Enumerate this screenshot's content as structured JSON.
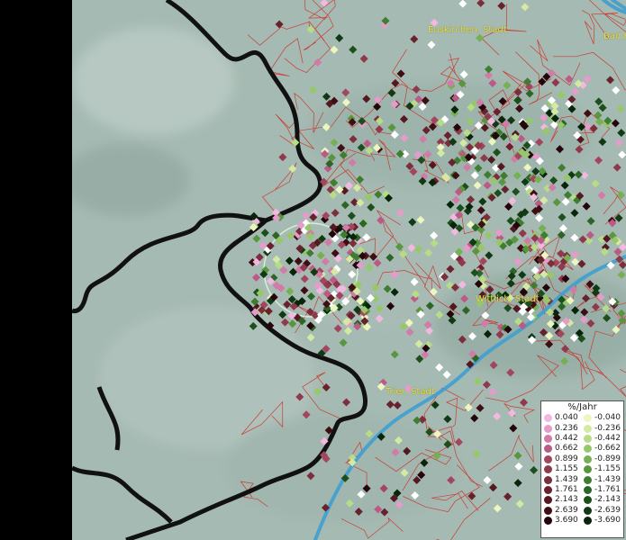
{
  "map": {
    "city_labels": [
      {
        "id": "euskirchen",
        "text": "Euskirchen, Stadt"
      },
      {
        "id": "bad",
        "text": "Bad H"
      },
      {
        "id": "wittlich",
        "text": "Wittlich, Stadt"
      },
      {
        "id": "trier",
        "text": "Trier, Stadt"
      }
    ]
  },
  "legend": {
    "title": "%/Jahr",
    "positive": [
      {
        "value": "0.040",
        "color": "#f2b8e0"
      },
      {
        "value": "0.236",
        "color": "#e59ccb"
      },
      {
        "value": "0.442",
        "color": "#d27aa8"
      },
      {
        "value": "0.662",
        "color": "#bb5a84"
      },
      {
        "value": "0.899",
        "color": "#a3455f"
      },
      {
        "value": "1.155",
        "color": "#8f3a4c"
      },
      {
        "value": "1.439",
        "color": "#7c2e3c"
      },
      {
        "value": "1.761",
        "color": "#68222d"
      },
      {
        "value": "2.143",
        "color": "#541820"
      },
      {
        "value": "2.639",
        "color": "#3e0e14"
      },
      {
        "value": "3.690",
        "color": "#26050a"
      }
    ],
    "negative": [
      {
        "value": "-0.040",
        "color": "#edf5c0"
      },
      {
        "value": "-0.236",
        "color": "#d4eaa2"
      },
      {
        "value": "-0.442",
        "color": "#b6dc86"
      },
      {
        "value": "-0.662",
        "color": "#96c86a"
      },
      {
        "value": "-0.899",
        "color": "#76b052"
      },
      {
        "value": "-1.155",
        "color": "#59973f"
      },
      {
        "value": "-1.439",
        "color": "#3f7d31"
      },
      {
        "value": "-1.761",
        "color": "#2c6526"
      },
      {
        "value": "-2.143",
        "color": "#1d4f1d"
      },
      {
        "value": "-2.639",
        "color": "#113a14"
      },
      {
        "value": "-3.690",
        "color": "#07250a"
      }
    ]
  },
  "colors": {
    "terrain": "#a3b9b1",
    "border": "#111111",
    "district_lines": "#d0281f",
    "river": "#3f9fd0",
    "label": "#e8e23a",
    "stable_point": "#ffffff"
  }
}
